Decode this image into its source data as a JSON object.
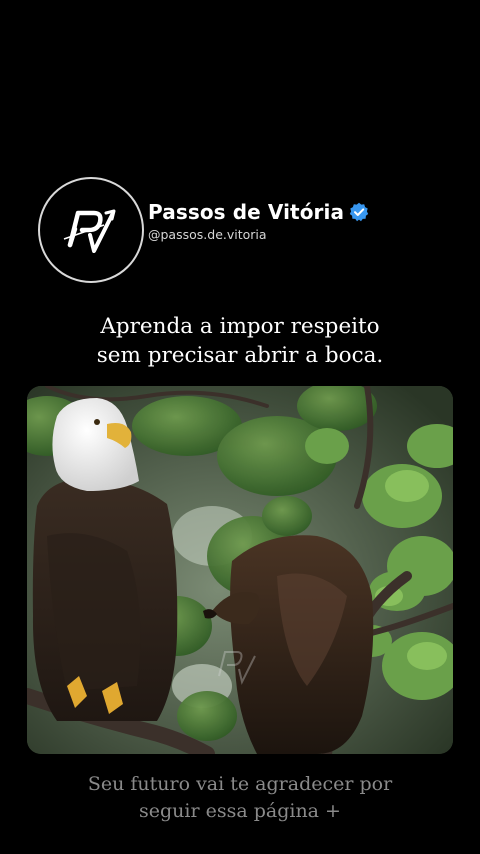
{
  "profile": {
    "name": "Passos de Vitória",
    "handle": "@passos.de.vitoria",
    "avatar_logo_text": "PV",
    "verified_icon": "verified-badge-icon",
    "verified_color": "#3897f0"
  },
  "caption": {
    "line1": "Aprenda a impor respeito",
    "line2": "sem precisar abrir a boca."
  },
  "photo": {
    "subject": "two eagles perched in a tree",
    "watermark_text": "PV"
  },
  "footer": {
    "line1": "Seu futuro vai te agradecer por",
    "line2": "seguir essa página +"
  },
  "colors": {
    "background": "#000000",
    "footer_text": "#8a8a8a"
  }
}
